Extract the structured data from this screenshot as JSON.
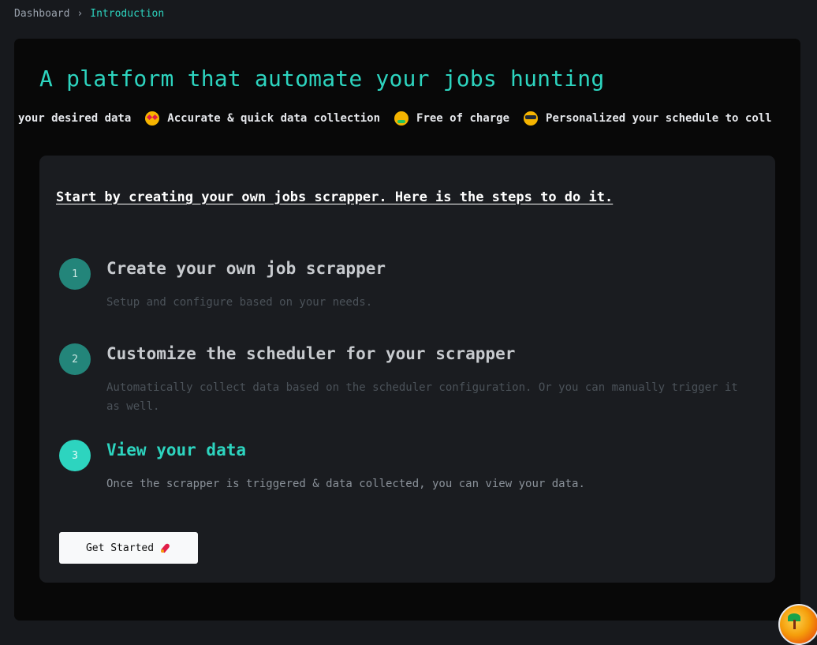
{
  "breadcrumb": {
    "items": [
      "Dashboard",
      "Introduction"
    ],
    "separator": "›"
  },
  "hero": {
    "title": "A platform that automate your jobs hunting"
  },
  "marquee": {
    "items": [
      {
        "icon": "",
        "text": "your desired data"
      },
      {
        "icon": "star-struck-emoji-icon",
        "text": "Accurate & quick data collection"
      },
      {
        "icon": "money-mouth-emoji-icon",
        "text": "Free of charge"
      },
      {
        "icon": "cool-sunglasses-emoji-icon",
        "text": "Personalized your schedule to coll"
      }
    ]
  },
  "card": {
    "heading": "Start by creating your own jobs scrapper. Here is the steps to do it.",
    "steps": [
      {
        "number": "1",
        "title": "Create your own job scrapper",
        "description": "Setup and configure based on your needs."
      },
      {
        "number": "2",
        "title": "Customize the scheduler for your scrapper",
        "description": "Automatically collect data based on the scheduler configuration. Or you can manually trigger it as well."
      },
      {
        "number": "3",
        "title": "View your data",
        "description": "Once the scrapper is triggered & data collected, you can view your data."
      }
    ],
    "cta": {
      "label": "Get Started",
      "icon": "rocket-icon"
    }
  },
  "colors": {
    "accent": "#2dd4bf",
    "accent_dark": "#23857a",
    "page_bg": "#17191d",
    "panel_bg": "#080808",
    "card_bg": "#1a1c20"
  }
}
